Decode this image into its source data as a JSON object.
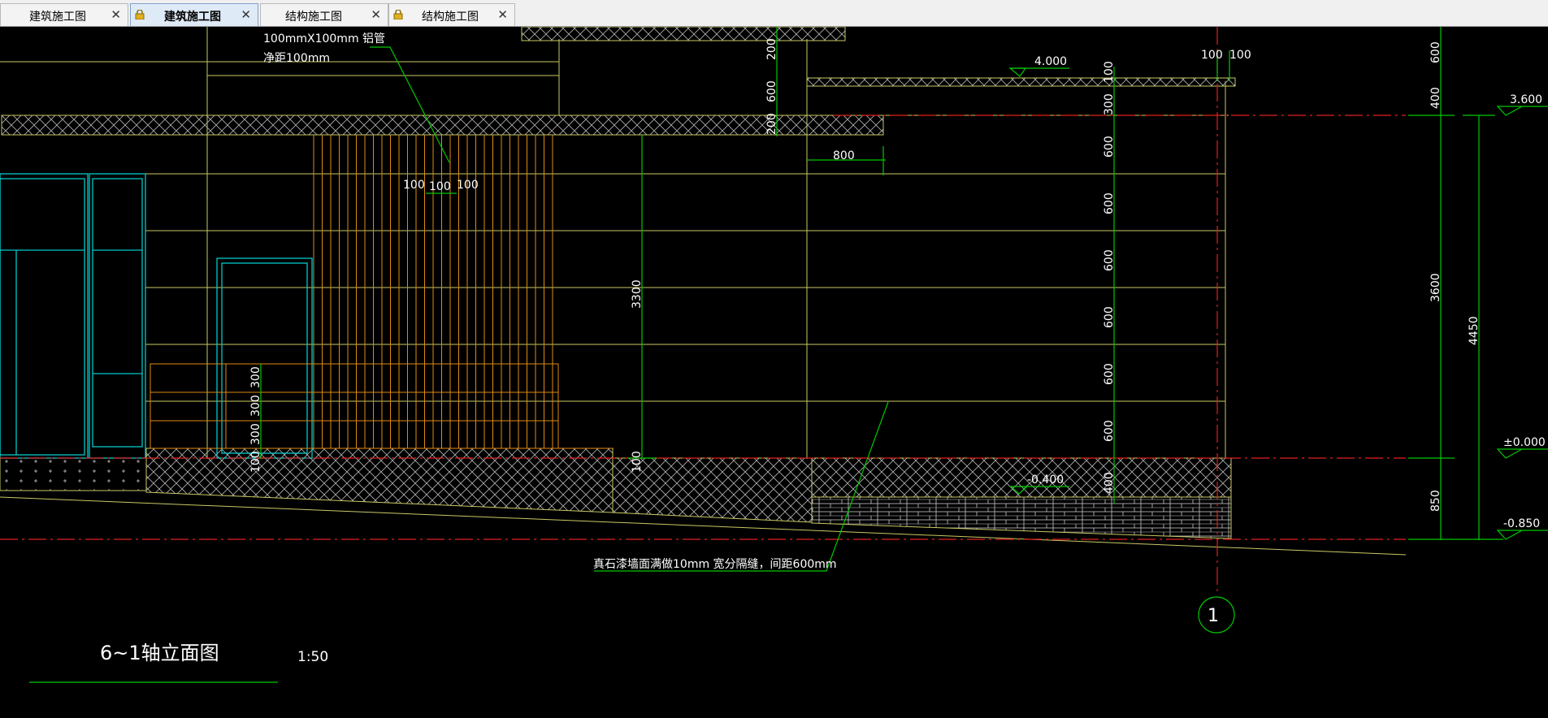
{
  "tabs": [
    {
      "label": "建筑施工图",
      "locked": false,
      "active": false
    },
    {
      "label": "建筑施工图",
      "locked": true,
      "active": true
    },
    {
      "label": "结构施工图",
      "locked": false,
      "active": false
    },
    {
      "label": "结构施工图",
      "locked": true,
      "active": false
    }
  ],
  "drawing": {
    "title": "6~1轴立面图",
    "scale": "1:50",
    "axis_label": "1",
    "note_pipe_line1": "100mmX100mm 铝管",
    "note_pipe_line2": "净距100mm",
    "note_wall": "真石漆墙面满做10mm 宽分隔缝，间距600mm",
    "elev_4000": "4.000",
    "elev_3600": "3.600",
    "elev_000": "±0.000",
    "elev_m0400": "-0.400",
    "elev_m0850": "-0.850",
    "dims": {
      "d100a": "100",
      "d100b": "100",
      "d100c": "100",
      "d100d": "100",
      "d100e": "100",
      "d800": "800",
      "d3300": "3300",
      "d3600": "3600",
      "d4450": "4450",
      "d850": "850",
      "d200a": "200",
      "d600a": "600",
      "d200b": "200",
      "d100v": "100",
      "d300v": "300",
      "d600_1": "600",
      "d600_2": "600",
      "d600_3": "600",
      "d600_4": "600",
      "d600_5": "600",
      "d600_6": "600",
      "d400v": "400",
      "d600top": "600",
      "d400top": "400",
      "p300a": "300",
      "p300b": "300",
      "p300c": "300",
      "p100": "100",
      "s100": "100"
    }
  },
  "colors": {
    "background": "#000000",
    "outline_yellow": "#c8c864",
    "dimension_green": "#00c800",
    "window_cyan": "#00c8c8",
    "orange_rails": "#e08a10",
    "axis_red": "#e02020",
    "hatch_white": "#c8c8c8"
  }
}
